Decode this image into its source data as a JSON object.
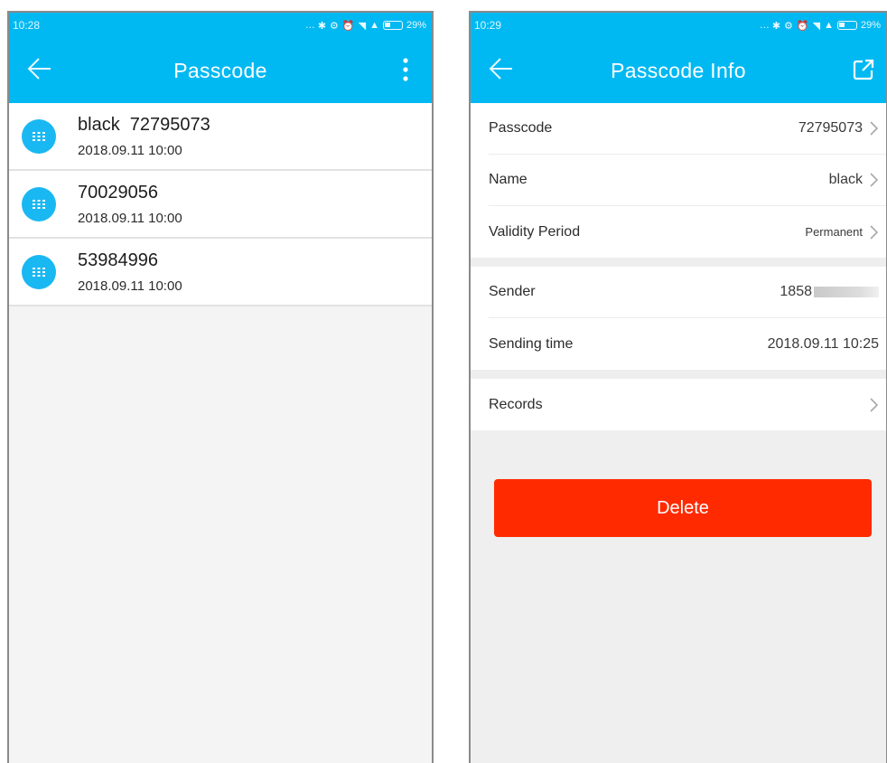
{
  "left_screen": {
    "status": {
      "time": "10:28",
      "battery": "29%"
    },
    "title": "Passcode",
    "items": [
      {
        "main": "black  72795073",
        "sub": "2018.09.11 10:00"
      },
      {
        "main": "70029056",
        "sub": "2018.09.11 10:00"
      },
      {
        "main": "53984996",
        "sub": "2018.09.11 10:00"
      }
    ]
  },
  "right_screen": {
    "status": {
      "time": "10:29",
      "battery": "29%"
    },
    "title": "Passcode Info",
    "rows": {
      "passcode": {
        "label": "Passcode",
        "value": "72795073"
      },
      "name": {
        "label": "Name",
        "value": "black"
      },
      "validity": {
        "label": "Validity Period",
        "value": "Permanent"
      },
      "sender": {
        "label": "Sender",
        "value": "1858"
      },
      "sending_time": {
        "label": "Sending time",
        "value": "2018.09.11 10:25"
      },
      "records": {
        "label": "Records"
      }
    },
    "delete_label": "Delete"
  },
  "colors": {
    "accent": "#00b9f2",
    "danger": "#ff2a00"
  },
  "icons": [
    "back-arrow-icon",
    "more-vert-icon",
    "share-icon",
    "keypad-icon",
    "chevron-right-icon"
  ]
}
